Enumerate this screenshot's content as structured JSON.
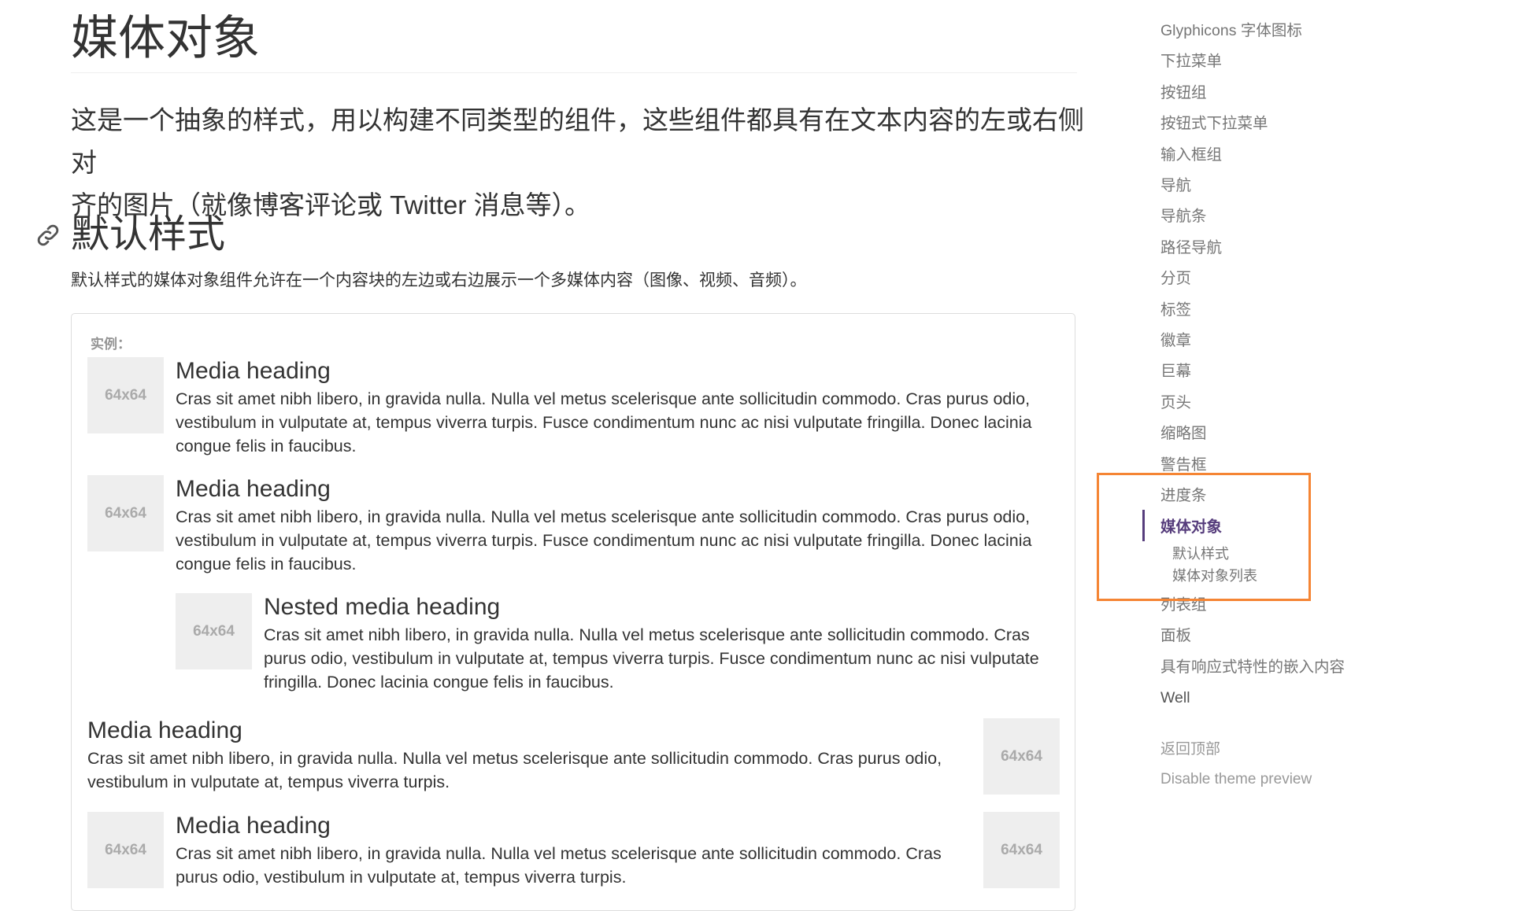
{
  "page": {
    "title": "媒体对象",
    "lead_line1": "这是一个抽象的样式，用以构建不同类型的组件，这些组件都具有在文本内容的左或右侧对",
    "lead_line2": "齐的图片（就像博客评论或 Twitter 消息等）。",
    "section_title": "默认样式",
    "section_desc": "默认样式的媒体对象组件允许在一个内容块的左边或右边展示一个多媒体内容（图像、视频、音频）。"
  },
  "example": {
    "label": "实例：",
    "thumb_label": "64x64",
    "items": [
      {
        "heading": "Media heading",
        "text": "Cras sit amet nibh libero, in gravida nulla. Nulla vel metus scelerisque ante sollicitudin commodo. Cras purus odio, vestibulum in vulputate at, tempus viverra turpis. Fusce condimentum nunc ac nisi vulputate fringilla. Donec lacinia congue felis in faucibus."
      },
      {
        "heading": "Media heading",
        "text": "Cras sit amet nibh libero, in gravida nulla. Nulla vel metus scelerisque ante sollicitudin commodo. Cras purus odio, vestibulum in vulputate at, tempus viverra turpis. Fusce condimentum nunc ac nisi vulputate fringilla. Donec lacinia congue felis in faucibus."
      },
      {
        "heading": "Nested media heading",
        "text": "Cras sit amet nibh libero, in gravida nulla. Nulla vel metus scelerisque ante sollicitudin commodo. Cras purus odio, vestibulum in vulputate at, tempus viverra turpis. Fusce condimentum nunc ac nisi vulputate fringilla. Donec lacinia congue felis in faucibus."
      },
      {
        "heading": "Media heading",
        "text": "Cras sit amet nibh libero, in gravida nulla. Nulla vel metus scelerisque ante sollicitudin commodo. Cras purus odio, vestibulum in vulputate at, tempus viverra turpis."
      },
      {
        "heading": "Media heading",
        "text": "Cras sit amet nibh libero, in gravida nulla. Nulla vel metus scelerisque ante sollicitudin commodo. Cras purus odio, vestibulum in vulputate at, tempus viverra turpis."
      }
    ]
  },
  "sidenav": {
    "items": [
      "Glyphicons 字体图标",
      "下拉菜单",
      "按钮组",
      "按钮式下拉菜单",
      "输入框组",
      "导航",
      "导航条",
      "路径导航",
      "分页",
      "标签",
      "徽章",
      "巨幕",
      "页头",
      "缩略图",
      "警告框",
      "进度条",
      "媒体对象",
      "列表组",
      "面板",
      "具有响应式特性的嵌入内容",
      "Well"
    ],
    "active_index": 16,
    "sub_items": [
      "默认样式",
      "媒体对象列表"
    ],
    "back_to_top": "返回顶部",
    "disable_theme": "Disable theme preview"
  },
  "colors": {
    "active": "#563d7c",
    "highlight": "#f58534",
    "thumb_bg": "#eeeeee"
  },
  "icons": {
    "anchor": "link-icon"
  }
}
